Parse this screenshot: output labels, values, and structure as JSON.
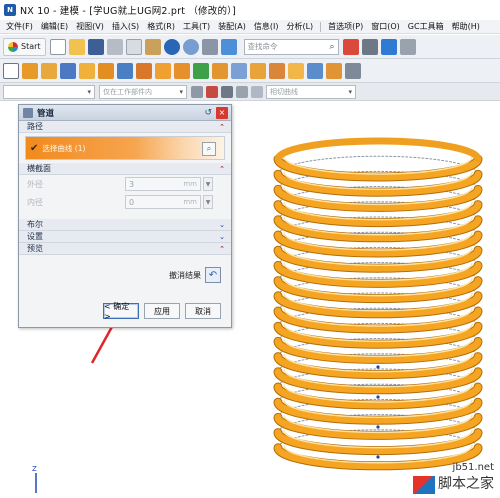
{
  "window": {
    "title": "NX 10 - 建模 - [学UG就上UG网2.prt （修改的）]"
  },
  "menu": [
    "文件(F)",
    "编辑(E)",
    "视图(V)",
    "插入(S)",
    "格式(R)",
    "工具(T)",
    "装配(A)",
    "信息(I)",
    "分析(L)",
    "首选项(P)",
    "窗口(O)",
    "GC工具箱",
    "帮助(H)"
  ],
  "toolbar": {
    "start_label": "Start",
    "search_placeholder": "查找命令",
    "selection_scope": "仅在工作部件内",
    "curve_rule": "相切曲线"
  },
  "dialog": {
    "title": "管道",
    "sections": {
      "path": "路径",
      "cross_section": "横截面",
      "boolean": "布尔",
      "settings": "设置",
      "preview": "预览"
    },
    "path_select_label": "选择曲线 (1)",
    "outer_diameter": {
      "label": "外径",
      "value": "3",
      "unit": "mm"
    },
    "inner_diameter": {
      "label": "内径",
      "value": "0",
      "unit": "mm"
    },
    "undo_result_label": "撤消结果",
    "buttons": {
      "ok": "< 确定 >",
      "apply": "应用",
      "cancel": "取消"
    }
  },
  "watermark": {
    "url": "jb51.net",
    "text": "脚本之家"
  },
  "colors": {
    "pipe": "#f4a21d",
    "pipe_dark": "#c47a08",
    "highlight_path": "#f28a1d",
    "arrow": "#e0262a"
  }
}
